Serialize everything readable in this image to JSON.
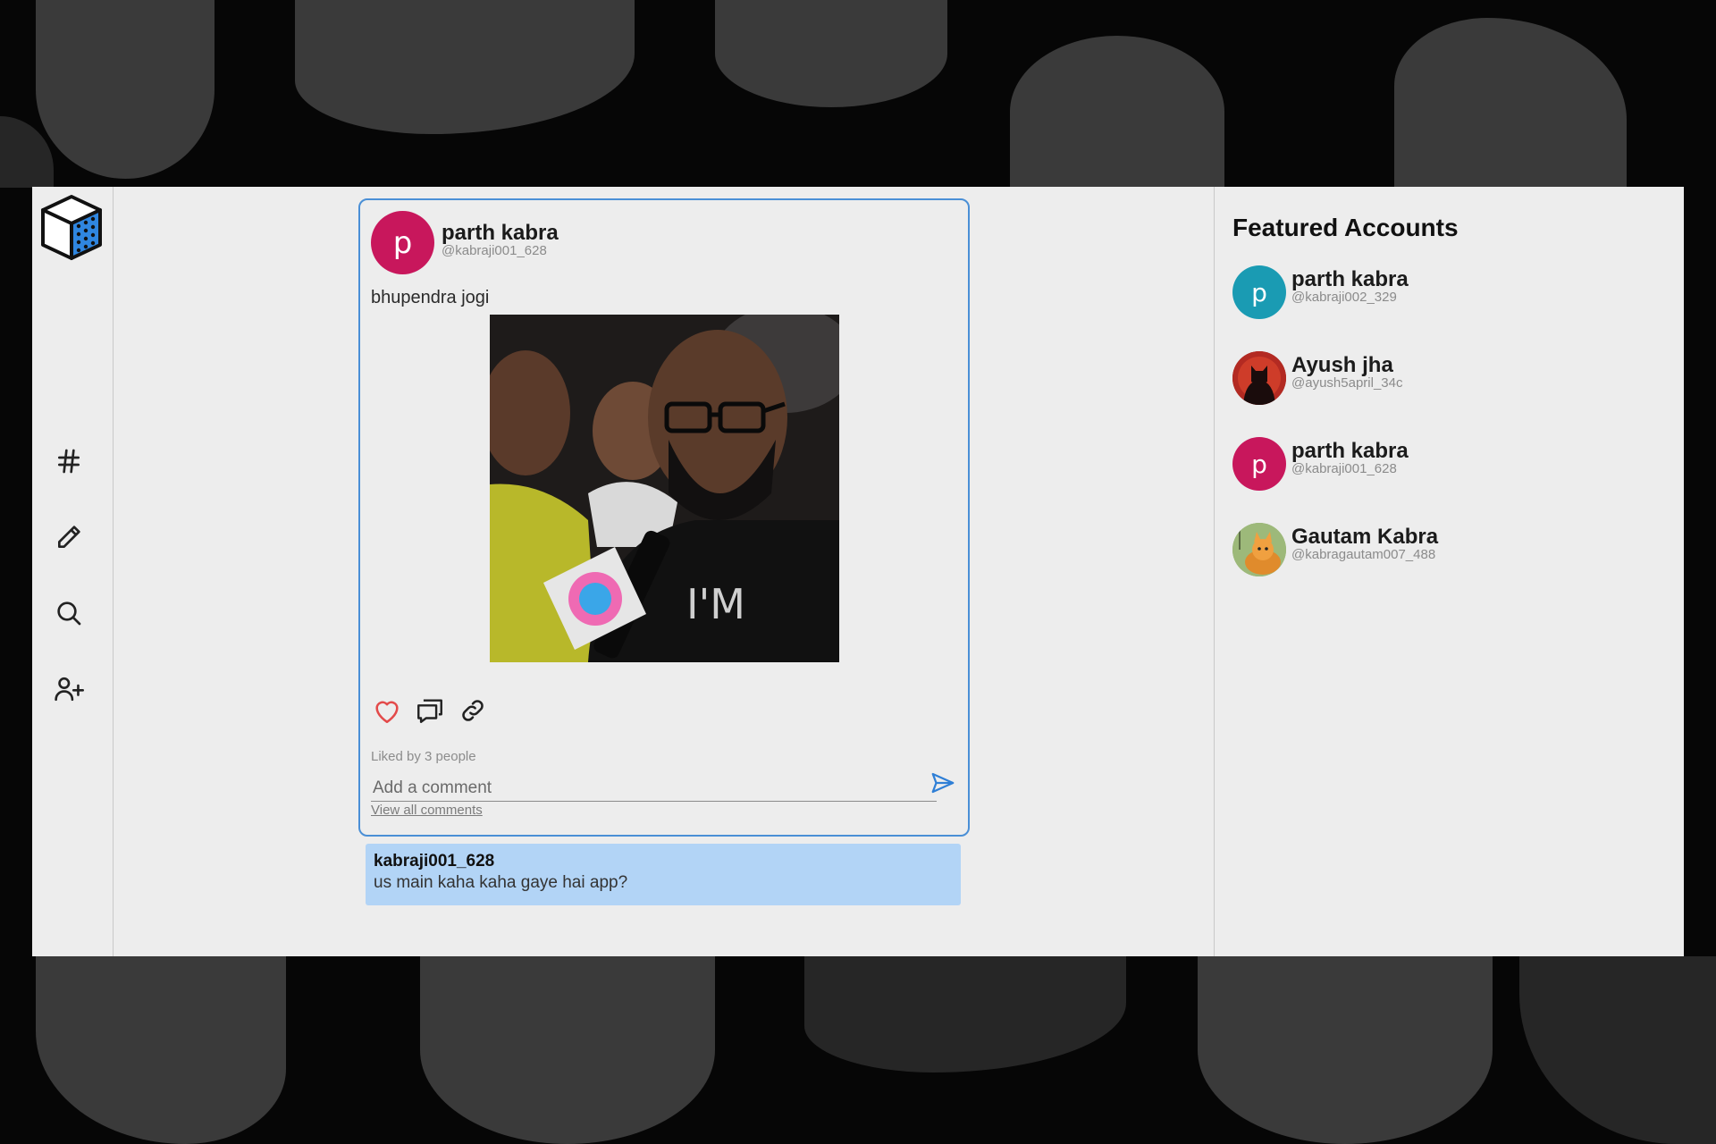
{
  "nav": {
    "logo": "cube-logo",
    "items": [
      {
        "name": "explore",
        "icon": "hashtag-icon"
      },
      {
        "name": "create-post",
        "icon": "pencil-icon"
      },
      {
        "name": "search",
        "icon": "search-icon"
      },
      {
        "name": "add-user",
        "icon": "user-plus-icon"
      }
    ]
  },
  "post": {
    "author": {
      "initial": "p",
      "name": "parth kabra",
      "handle": "@kabraji001_628",
      "avatar_color": "#c8175c"
    },
    "caption": "bhupendra jogi",
    "image_alt": "photo",
    "image_text": "I'M",
    "likes_text": "Liked by 3 people",
    "comment_placeholder": "Add a comment",
    "view_all_label": "View all comments"
  },
  "comments": [
    {
      "user": "kabraji001_628",
      "text": "us main kaha kaha gaye hai app?"
    }
  ],
  "featured": {
    "title": "Featured Accounts",
    "accounts": [
      {
        "initial": "p",
        "name": "parth kabra",
        "handle": "@kabraji002_329",
        "avatar_color": "#1a9bb3"
      },
      {
        "initial": "",
        "name": "Ayush jha",
        "handle": "@ayush5april_34c",
        "avatar_color": "#8b1a1a"
      },
      {
        "initial": "p",
        "name": "parth kabra",
        "handle": "@kabraji001_628",
        "avatar_color": "#c8175c"
      },
      {
        "initial": "",
        "name": "Gautam Kabra",
        "handle": "@kabragautam007_488",
        "avatar_color": "#8fae6a"
      }
    ]
  },
  "colors": {
    "accent": "#4a8fd6",
    "like": "#e34a4a",
    "comment_bg": "#b2d4f6",
    "panel_bg": "#ededed"
  }
}
